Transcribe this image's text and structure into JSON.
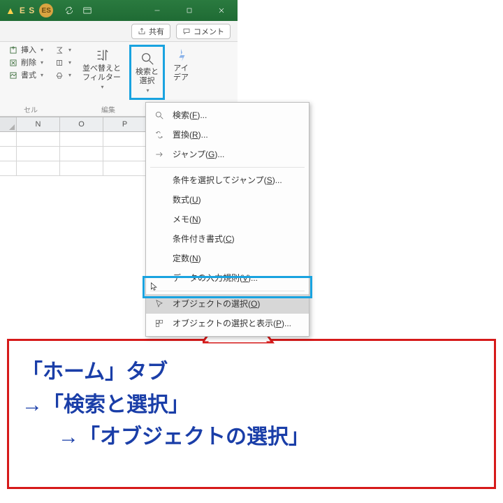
{
  "titlebar": {
    "user_initials": "E S",
    "badge": "ES"
  },
  "sharebar": {
    "share": "共有",
    "comment": "コメント"
  },
  "ribbon": {
    "insert": "挿入",
    "delete": "削除",
    "format": "書式",
    "sort_filter": "並べ替えと\nフィルター",
    "find_select": "検索と\n選択",
    "ideas": "アイ\nデア",
    "group_cells": "セル",
    "group_edit": "編集"
  },
  "columns": [
    "N",
    "O",
    "P"
  ],
  "menu": {
    "find": "検索(F)...",
    "replace": "置換(R)...",
    "goto": "ジャンプ(G)...",
    "goto_special": "条件を選択してジャンプ(S)...",
    "formulas": "数式(U)",
    "notes": "メモ(N)",
    "cond_format": "条件付き書式(C)",
    "constants": "定数(N)",
    "validation": "データの入力規則(V)...",
    "select_objects": "オブジェクトの選択(O)",
    "selection_pane": "オブジェクトの選択と表示(P)..."
  },
  "callout": {
    "l1": "「ホーム」タブ",
    "l2": "→「検索と選択」",
    "l3": "→「オブジェクトの選択」"
  }
}
